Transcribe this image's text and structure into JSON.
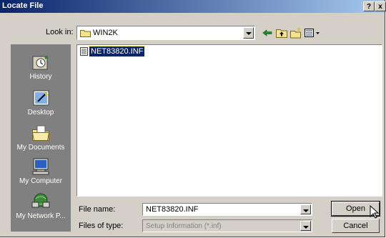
{
  "window": {
    "title": "Locate File",
    "help": "?",
    "close": "x"
  },
  "lookin": {
    "label": "Look in:",
    "value": "WIN2K"
  },
  "toolbar": {
    "icons": [
      "back-arrow-icon",
      "up-folder-icon",
      "new-folder-icon",
      "view-menu-icon"
    ]
  },
  "places": [
    {
      "label": "History",
      "icon": "history-icon"
    },
    {
      "label": "Desktop",
      "icon": "desktop-icon"
    },
    {
      "label": "My Documents",
      "icon": "my-documents-icon"
    },
    {
      "label": "My Computer",
      "icon": "my-computer-icon"
    },
    {
      "label": "My Network P...",
      "icon": "network-places-icon"
    }
  ],
  "files": [
    {
      "name": "NET83820.INF",
      "selected": true
    }
  ],
  "filename": {
    "label": "File name:",
    "value": "NET83820.INF"
  },
  "filetype": {
    "label": "Files of type:",
    "value": "Setup Information (*.inf)"
  },
  "buttons": {
    "open": "Open",
    "cancel": "Cancel"
  },
  "colors": {
    "titlebar": "#0a246a",
    "face": "#d4d0c8",
    "places": "#808080",
    "selection": "#0a246a"
  }
}
